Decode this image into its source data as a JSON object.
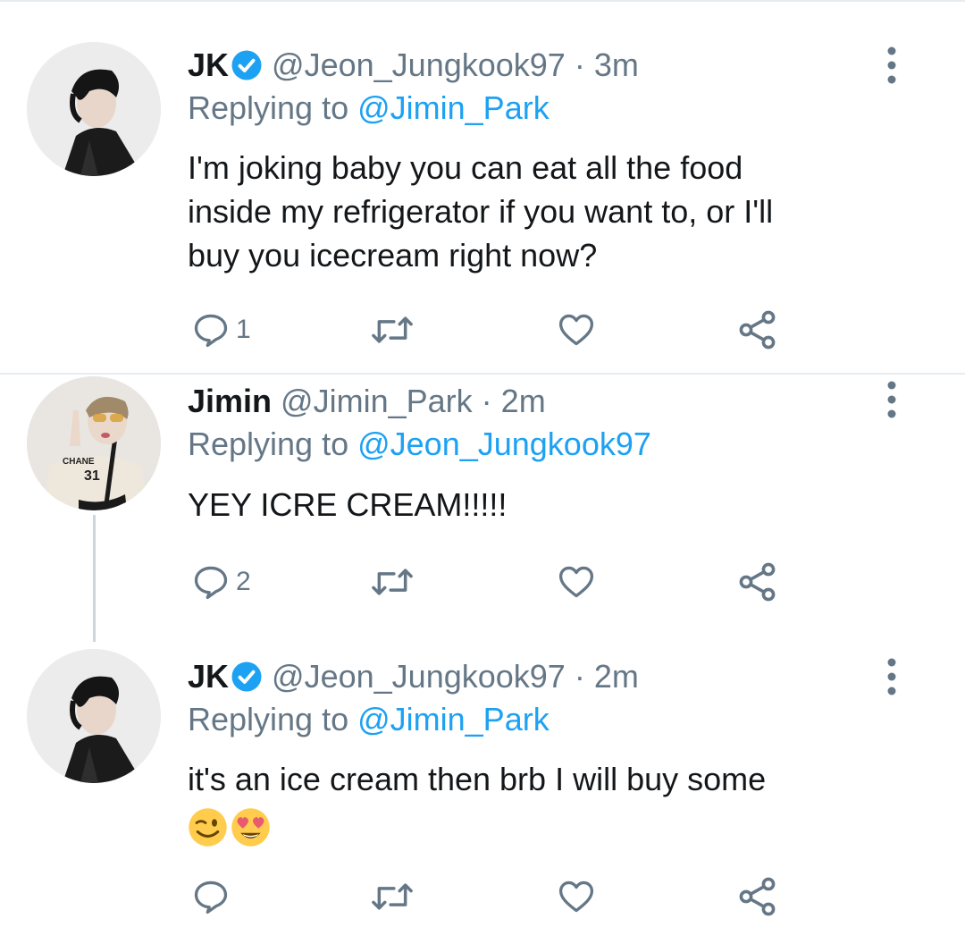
{
  "tweets": [
    {
      "name": "JK",
      "verified": true,
      "handle": "@Jeon_Jungkook97",
      "dot": "·",
      "time": "3m",
      "replying_prefix": "Replying to ",
      "replying_to": "@Jimin_Park",
      "text_lines": [
        "I'm joking baby you can eat all the food",
        "inside my refrigerator if you want to,  or I'll",
        "buy you icecream right now?"
      ],
      "reply_count": "1",
      "avatar_icon": "avatar-jk-photo"
    },
    {
      "name": "Jimin",
      "verified": false,
      "handle": "@Jimin_Park",
      "dot": "·",
      "time": "2m",
      "replying_prefix": "Replying to ",
      "replying_to": "@Jeon_Jungkook97",
      "text_lines": [
        "YEY ICRE CREAM!!!!!"
      ],
      "reply_count": "2",
      "avatar_icon": "avatar-jimin-photo",
      "avatar_shirt_text": "CHANE",
      "avatar_shirt_number": "31"
    },
    {
      "name": "JK",
      "verified": true,
      "handle": "@Jeon_Jungkook97",
      "dot": "·",
      "time": "2m",
      "replying_prefix": "Replying to ",
      "replying_to": "@Jimin_Park",
      "text_lines": [
        "it's an ice cream then brb I will buy some"
      ],
      "emojis": [
        "winking-face",
        "smiling-face-with-heart-eyes"
      ],
      "reply_count": "",
      "avatar_icon": "avatar-jk-photo"
    }
  ],
  "icons": [
    "reply-icon",
    "retweet-icon",
    "like-icon",
    "share-icon",
    "more-options-icon",
    "verified-badge-icon"
  ],
  "colors": {
    "accent": "#1da1f2",
    "secondary_text": "#657786",
    "primary_text": "#14171a",
    "divider": "#e6ecf0",
    "thread_line": "#ccd6dd"
  }
}
